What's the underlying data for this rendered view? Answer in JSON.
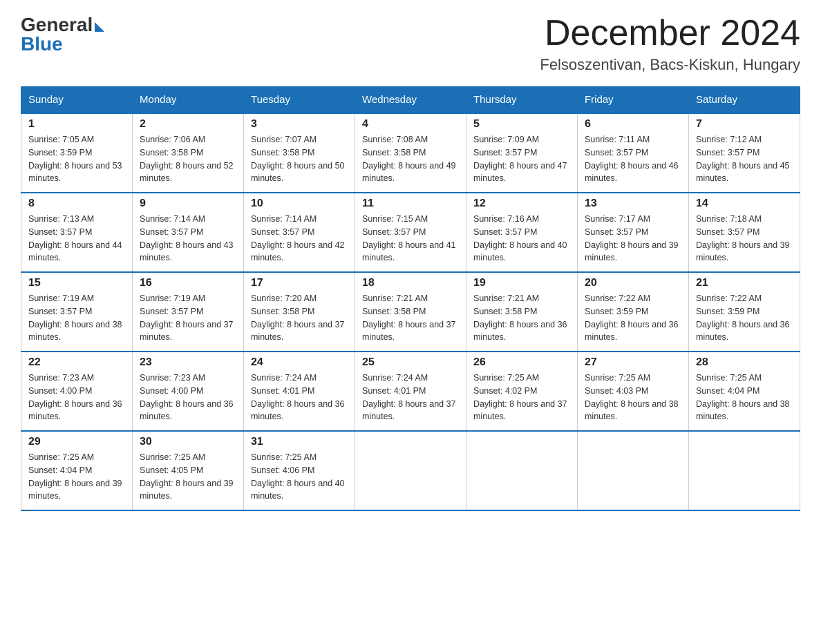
{
  "header": {
    "logo_general": "General",
    "logo_blue": "Blue",
    "month_title": "December 2024",
    "location": "Felsoszentivan, Bacs-Kiskun, Hungary"
  },
  "weekdays": [
    "Sunday",
    "Monday",
    "Tuesday",
    "Wednesday",
    "Thursday",
    "Friday",
    "Saturday"
  ],
  "weeks": [
    [
      {
        "day": "1",
        "sunrise": "7:05 AM",
        "sunset": "3:59 PM",
        "daylight": "8 hours and 53 minutes."
      },
      {
        "day": "2",
        "sunrise": "7:06 AM",
        "sunset": "3:58 PM",
        "daylight": "8 hours and 52 minutes."
      },
      {
        "day": "3",
        "sunrise": "7:07 AM",
        "sunset": "3:58 PM",
        "daylight": "8 hours and 50 minutes."
      },
      {
        "day": "4",
        "sunrise": "7:08 AM",
        "sunset": "3:58 PM",
        "daylight": "8 hours and 49 minutes."
      },
      {
        "day": "5",
        "sunrise": "7:09 AM",
        "sunset": "3:57 PM",
        "daylight": "8 hours and 47 minutes."
      },
      {
        "day": "6",
        "sunrise": "7:11 AM",
        "sunset": "3:57 PM",
        "daylight": "8 hours and 46 minutes."
      },
      {
        "day": "7",
        "sunrise": "7:12 AM",
        "sunset": "3:57 PM",
        "daylight": "8 hours and 45 minutes."
      }
    ],
    [
      {
        "day": "8",
        "sunrise": "7:13 AM",
        "sunset": "3:57 PM",
        "daylight": "8 hours and 44 minutes."
      },
      {
        "day": "9",
        "sunrise": "7:14 AM",
        "sunset": "3:57 PM",
        "daylight": "8 hours and 43 minutes."
      },
      {
        "day": "10",
        "sunrise": "7:14 AM",
        "sunset": "3:57 PM",
        "daylight": "8 hours and 42 minutes."
      },
      {
        "day": "11",
        "sunrise": "7:15 AM",
        "sunset": "3:57 PM",
        "daylight": "8 hours and 41 minutes."
      },
      {
        "day": "12",
        "sunrise": "7:16 AM",
        "sunset": "3:57 PM",
        "daylight": "8 hours and 40 minutes."
      },
      {
        "day": "13",
        "sunrise": "7:17 AM",
        "sunset": "3:57 PM",
        "daylight": "8 hours and 39 minutes."
      },
      {
        "day": "14",
        "sunrise": "7:18 AM",
        "sunset": "3:57 PM",
        "daylight": "8 hours and 39 minutes."
      }
    ],
    [
      {
        "day": "15",
        "sunrise": "7:19 AM",
        "sunset": "3:57 PM",
        "daylight": "8 hours and 38 minutes."
      },
      {
        "day": "16",
        "sunrise": "7:19 AM",
        "sunset": "3:57 PM",
        "daylight": "8 hours and 37 minutes."
      },
      {
        "day": "17",
        "sunrise": "7:20 AM",
        "sunset": "3:58 PM",
        "daylight": "8 hours and 37 minutes."
      },
      {
        "day": "18",
        "sunrise": "7:21 AM",
        "sunset": "3:58 PM",
        "daylight": "8 hours and 37 minutes."
      },
      {
        "day": "19",
        "sunrise": "7:21 AM",
        "sunset": "3:58 PM",
        "daylight": "8 hours and 36 minutes."
      },
      {
        "day": "20",
        "sunrise": "7:22 AM",
        "sunset": "3:59 PM",
        "daylight": "8 hours and 36 minutes."
      },
      {
        "day": "21",
        "sunrise": "7:22 AM",
        "sunset": "3:59 PM",
        "daylight": "8 hours and 36 minutes."
      }
    ],
    [
      {
        "day": "22",
        "sunrise": "7:23 AM",
        "sunset": "4:00 PM",
        "daylight": "8 hours and 36 minutes."
      },
      {
        "day": "23",
        "sunrise": "7:23 AM",
        "sunset": "4:00 PM",
        "daylight": "8 hours and 36 minutes."
      },
      {
        "day": "24",
        "sunrise": "7:24 AM",
        "sunset": "4:01 PM",
        "daylight": "8 hours and 36 minutes."
      },
      {
        "day": "25",
        "sunrise": "7:24 AM",
        "sunset": "4:01 PM",
        "daylight": "8 hours and 37 minutes."
      },
      {
        "day": "26",
        "sunrise": "7:25 AM",
        "sunset": "4:02 PM",
        "daylight": "8 hours and 37 minutes."
      },
      {
        "day": "27",
        "sunrise": "7:25 AM",
        "sunset": "4:03 PM",
        "daylight": "8 hours and 38 minutes."
      },
      {
        "day": "28",
        "sunrise": "7:25 AM",
        "sunset": "4:04 PM",
        "daylight": "8 hours and 38 minutes."
      }
    ],
    [
      {
        "day": "29",
        "sunrise": "7:25 AM",
        "sunset": "4:04 PM",
        "daylight": "8 hours and 39 minutes."
      },
      {
        "day": "30",
        "sunrise": "7:25 AM",
        "sunset": "4:05 PM",
        "daylight": "8 hours and 39 minutes."
      },
      {
        "day": "31",
        "sunrise": "7:25 AM",
        "sunset": "4:06 PM",
        "daylight": "8 hours and 40 minutes."
      },
      null,
      null,
      null,
      null
    ]
  ]
}
